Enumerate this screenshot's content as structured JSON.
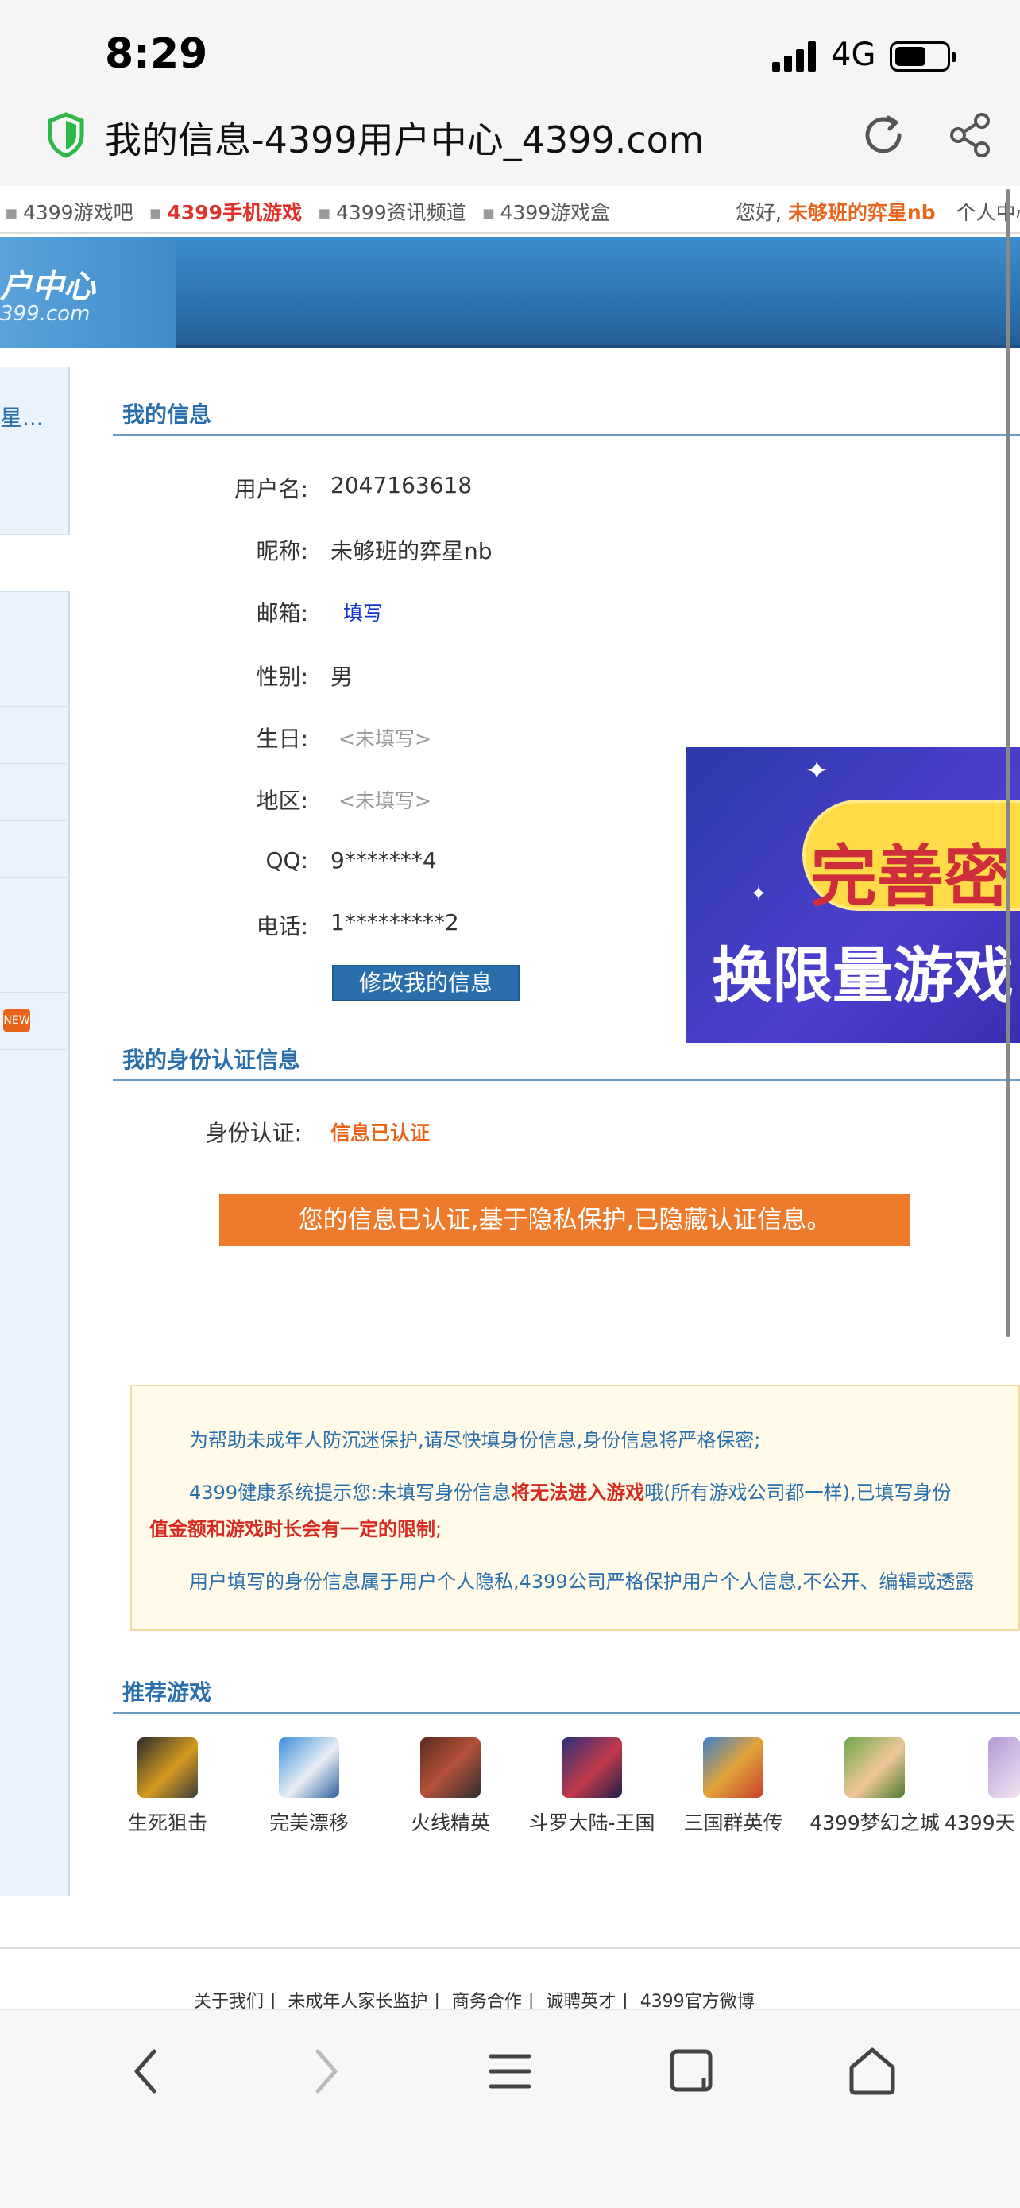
{
  "status": {
    "time": "8:29",
    "network": "4G"
  },
  "browser": {
    "title": "我的信息-4399用户中心_4399.com"
  },
  "topnav": {
    "links": [
      "4399游戏吧",
      "4399手机游戏",
      "4399资讯频道",
      "4399游戏盒"
    ],
    "greeting": "您好,",
    "username": "未够班的弈星nb",
    "center": "个人中心"
  },
  "banner": {
    "logo_line1": "户中心",
    "logo_line2": "399.com"
  },
  "sidebar": {
    "truncated_item": "星..."
  },
  "info": {
    "title": "我的信息",
    "fields": [
      {
        "label": "用户名:",
        "value": "2047163618"
      },
      {
        "label": "昵称:",
        "value": "未够班的弈星nb"
      },
      {
        "label": "邮箱:",
        "value": "填写"
      },
      {
        "label": "性别:",
        "value": "男"
      },
      {
        "label": "生日:",
        "value": "<未填写>"
      },
      {
        "label": "地区:",
        "value": "<未填写>"
      },
      {
        "label": "QQ:",
        "value": "9*******4"
      },
      {
        "label": "电话:",
        "value": "1*********2"
      }
    ],
    "edit_button": "修改我的信息"
  },
  "ad": {
    "line1": "完善密",
    "line2": "换限量游戏"
  },
  "identity": {
    "title": "我的身份认证信息",
    "label": "身份认证:",
    "status": "信息已认证",
    "notice": "您的信息已认证,基于隐私保护,已隐藏认证信息。"
  },
  "tips": {
    "line1": "为帮助未成年人防沉迷保护,请尽快填身份信息,身份信息将严格保密;",
    "line2a": "4399健康系统提示您:未填写身份信息",
    "line2b": "将无法进入游戏",
    "line2c": "哦(所有游戏公司都一样),已填写身份",
    "line3": "值金额和游戏时长会有一定的限制",
    "line3end": ";",
    "line4": "用户填写的身份信息属于用户个人隐私,4399公司严格保护用户个人信息,不公开、编辑或透露"
  },
  "recommend": {
    "title": "推荐游戏",
    "games": [
      "生死狙击",
      "完美漂移",
      "火线精英",
      "斗罗大陆-王国",
      "三国群英传",
      "4399梦幻之城",
      "4399天"
    ]
  },
  "footer": {
    "links": [
      "关于我们",
      "未成年人家长监护",
      "商务合作",
      "诚聘英才",
      "4399官方微博"
    ]
  },
  "colors": {
    "brand_blue": "#2a6fab",
    "orange": "#ee7a2c",
    "red": "#e0312a"
  }
}
